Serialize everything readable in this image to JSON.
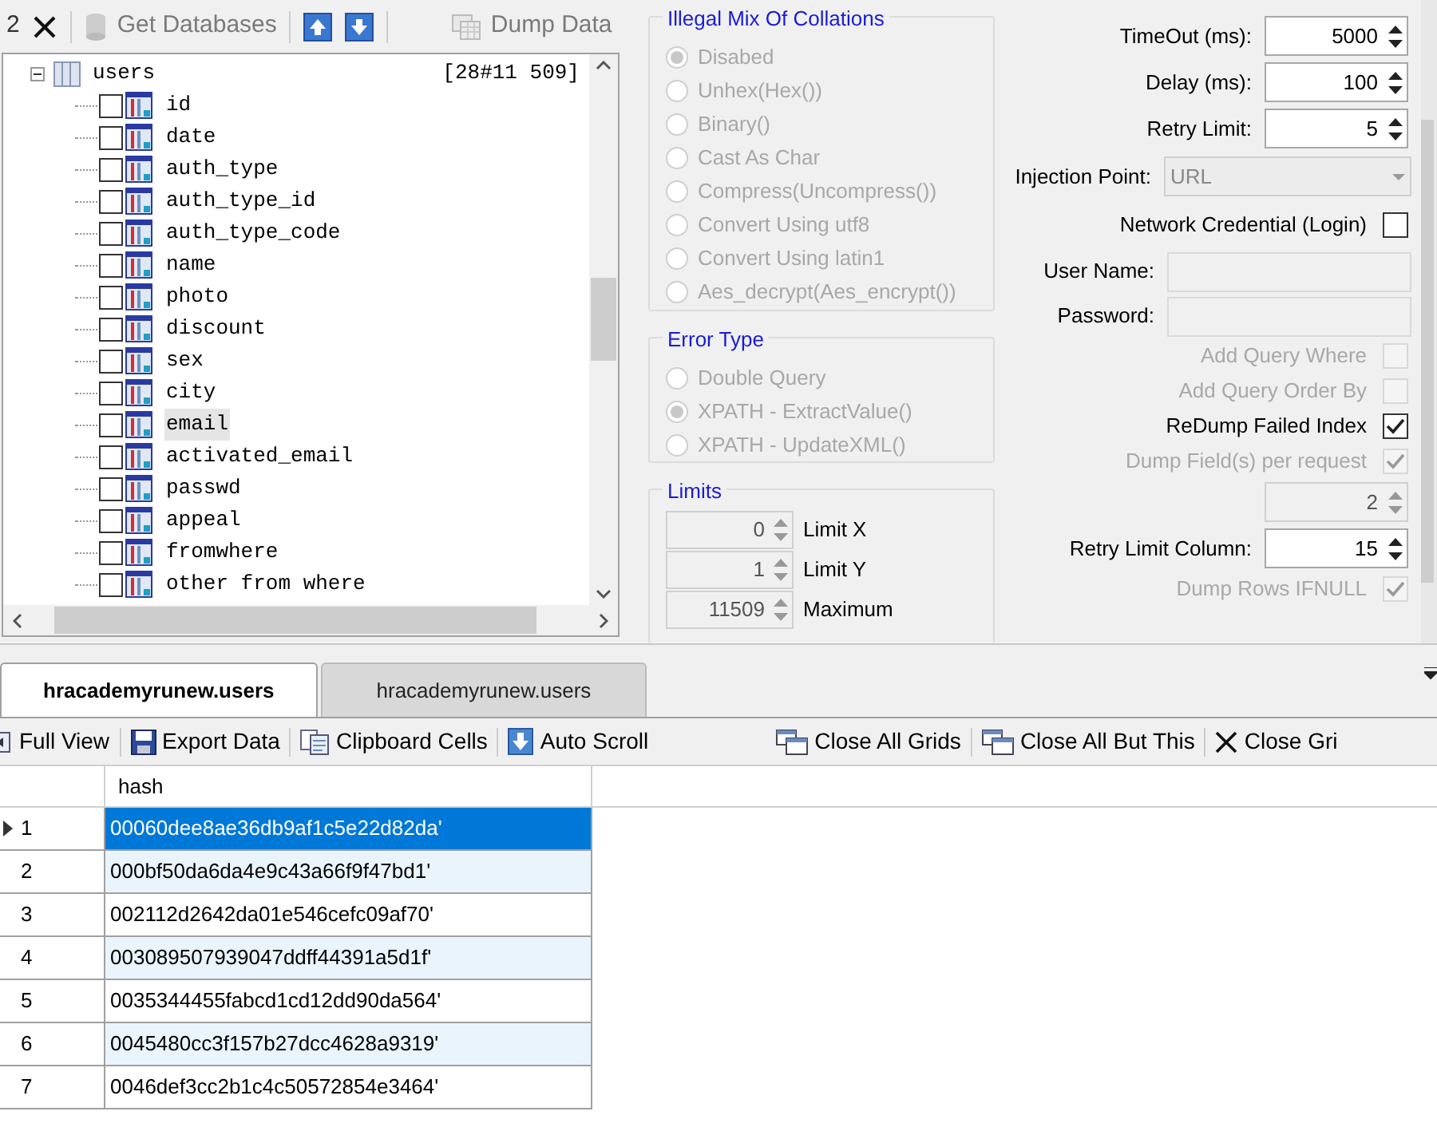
{
  "toolbar": {
    "items": [
      {
        "kind": "text",
        "label": "2"
      },
      {
        "kind": "close"
      },
      {
        "kind": "database",
        "label": "Get Databases",
        "disabled": true
      },
      {
        "kind": "up"
      },
      {
        "kind": "down"
      },
      {
        "kind": "dump",
        "label": "Dump Data",
        "disabled": true
      }
    ]
  },
  "tree": {
    "table": {
      "name": "users",
      "count": "[28#11 509]",
      "expanded": true,
      "children": [
        {
          "name": "id",
          "checked": false,
          "selected": false
        },
        {
          "name": "date",
          "checked": false,
          "selected": false
        },
        {
          "name": "auth_type",
          "checked": false,
          "selected": false
        },
        {
          "name": "auth_type_id",
          "checked": false,
          "selected": false
        },
        {
          "name": "auth_type_code",
          "checked": false,
          "selected": false
        },
        {
          "name": "name",
          "checked": false,
          "selected": false
        },
        {
          "name": "photo",
          "checked": false,
          "selected": false
        },
        {
          "name": "discount",
          "checked": false,
          "selected": false
        },
        {
          "name": "sex",
          "checked": false,
          "selected": false
        },
        {
          "name": "city",
          "checked": false,
          "selected": false
        },
        {
          "name": "email",
          "checked": false,
          "selected": true
        },
        {
          "name": "activated_email",
          "checked": false,
          "selected": false
        },
        {
          "name": "passwd",
          "checked": false,
          "selected": false
        },
        {
          "name": "appeal",
          "checked": false,
          "selected": false
        },
        {
          "name": "fromwhere",
          "checked": false,
          "selected": false
        },
        {
          "name": "other from where",
          "checked": false,
          "selected": false
        }
      ]
    }
  },
  "collations": {
    "title": "Illegal Mix Of Collations",
    "disabled": true,
    "options": [
      {
        "label": "Disabed",
        "selected": true
      },
      {
        "label": "Unhex(Hex())",
        "selected": false
      },
      {
        "label": "Binary()",
        "selected": false
      },
      {
        "label": "Cast As Char",
        "selected": false
      },
      {
        "label": "Compress(Uncompress())",
        "selected": false
      },
      {
        "label": "Convert Using utf8",
        "selected": false
      },
      {
        "label": "Convert Using latin1",
        "selected": false
      },
      {
        "label": "Aes_decrypt(Aes_encrypt())",
        "selected": false
      }
    ]
  },
  "error_type": {
    "title": "Error Type",
    "disabled": true,
    "options": [
      {
        "label": "Double Query",
        "selected": false
      },
      {
        "label": "XPATH - ExtractValue()",
        "selected": true
      },
      {
        "label": "XPATH - UpdateXML()",
        "selected": false
      }
    ]
  },
  "limits": {
    "title": "Limits",
    "fields": [
      {
        "value": "0",
        "label": "Limit X"
      },
      {
        "value": "1",
        "label": "Limit Y"
      },
      {
        "value": "11509",
        "label": "Maximum"
      }
    ]
  },
  "settings": [
    {
      "kind": "spin",
      "label": "TimeOut (ms):",
      "value": "5000",
      "disabled": false
    },
    {
      "kind": "spin",
      "label": "Delay  (ms):",
      "value": "100",
      "disabled": false
    },
    {
      "kind": "spin",
      "label": "Retry Limit:",
      "value": "5",
      "disabled": false
    },
    {
      "kind": "select",
      "label": "Injection Point:",
      "value": "URL",
      "disabled": true
    },
    {
      "kind": "check",
      "label": "Network Credential (Login)",
      "checked": false,
      "disabled": false
    },
    {
      "kind": "text",
      "label": "User Name:",
      "disabled": true
    },
    {
      "kind": "text",
      "label": "Password:",
      "disabled": true
    },
    {
      "kind": "check",
      "label": "Add Query Where",
      "checked": false,
      "disabled": true
    },
    {
      "kind": "check",
      "label": "Add Query Order By",
      "checked": false,
      "disabled": true
    },
    {
      "kind": "check",
      "label": "ReDump Failed Index",
      "checked": true,
      "disabled": false
    },
    {
      "kind": "check",
      "label": "Dump Field(s) per request",
      "checked": true,
      "disabled": true
    },
    {
      "kind": "spin",
      "value": "2",
      "disabled": true
    },
    {
      "kind": "spin",
      "label": "Retry Limit Column:",
      "value": "15",
      "disabled": false
    },
    {
      "kind": "check",
      "label": "Dump Rows IFNULL",
      "checked": true,
      "disabled": true
    }
  ],
  "tabs": [
    {
      "label": "hracademyrunew.users",
      "selected": true
    },
    {
      "label": "hracademyrunew.users",
      "selected": false
    }
  ],
  "grid_toolbar": [
    {
      "kind": "view",
      "label": "Full View"
    },
    {
      "kind": "save",
      "label": "Export Data"
    },
    {
      "kind": "copy",
      "label": "Clipboard Cells"
    },
    {
      "kind": "scroll",
      "label": "Auto Scroll"
    },
    {
      "kind": "spacer"
    },
    {
      "kind": "grids",
      "label": "Close All Grids"
    },
    {
      "kind": "grids2",
      "label": "Close All But This"
    },
    {
      "kind": "close",
      "label": "Close Gri"
    }
  ],
  "grid": {
    "columns": [
      "hash"
    ],
    "rows": [
      {
        "index": "1",
        "hash": "00060dee8ae36db9af1c5e22d82da'",
        "selected": true
      },
      {
        "index": "2",
        "hash": "000bf50da6da4e9c43a66f9f47bd1'",
        "selected": false
      },
      {
        "index": "3",
        "hash": "002112d2642da01e546cefc09af70'",
        "selected": false
      },
      {
        "index": "4",
        "hash": "003089507939047ddff44391a5d1f'",
        "selected": false
      },
      {
        "index": "5",
        "hash": "0035344455fabcd1cd12dd90da564'",
        "selected": false
      },
      {
        "index": "6",
        "hash": "0045480cc3f157b27dcc4628a9319'",
        "selected": false
      },
      {
        "index": "7",
        "hash": "0046def3cc2b1c4c50572854e3464'",
        "selected": false
      }
    ]
  }
}
